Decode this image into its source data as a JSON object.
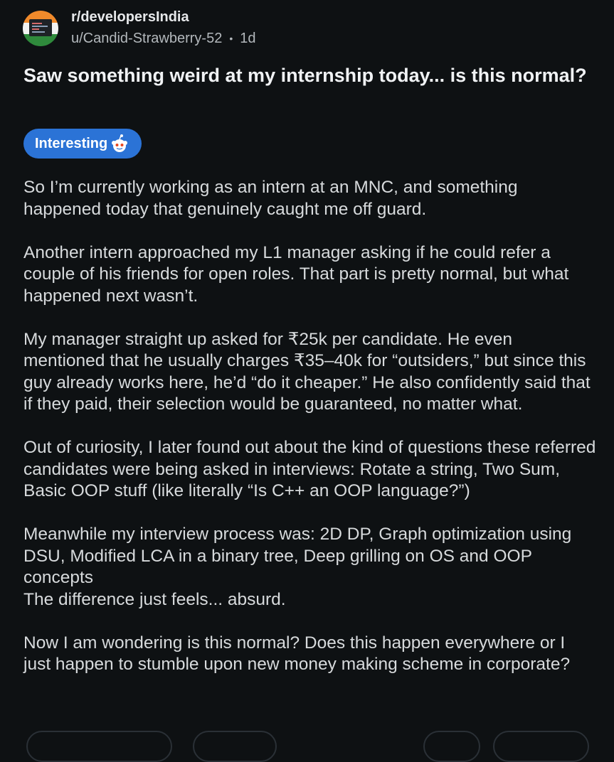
{
  "post": {
    "subreddit": "r/developersIndia",
    "author": "u/Candid-Strawberry-52",
    "separator": "•",
    "age": "1d",
    "title": "Saw something weird at my internship today... is this normal?",
    "flair": "Interesting",
    "body": {
      "p1": "So I’m currently working as an intern at an MNC, and something happened today that genuinely caught me off guard.",
      "p2": "Another intern approached my L1 manager asking if he could refer a couple of his friends for open roles. That part is pretty normal, but what happened next wasn’t.",
      "p3": "My manager straight up asked for ₹25k per candidate. He even mentioned that he usually charges ₹35–40k for “outsiders,” but since this guy already works here, he’d “do it cheaper.” He also confidently said that if they paid, their selection would be guaranteed, no matter what.",
      "p4": "Out of curiosity, I later found out about the kind of questions these referred candidates were being asked in interviews: Rotate a string, Two Sum, Basic OOP stuff (like literally “Is C++ an OOP language?”)",
      "p5a": "Meanwhile my interview process was: 2D DP, Graph optimization using DSU, Modified LCA in a binary tree, Deep grilling on OS and OOP concepts",
      "p5b": "The difference just feels... absurd.",
      "p6": "Now I am wondering is this normal? Does this happen everywhere or I just happen to stumble upon new money making scheme in corporate?"
    }
  },
  "icons": {
    "avatar": "subreddit-avatar-icon",
    "flair_emoji": "snoo-icon"
  },
  "colors": {
    "background": "#0e1113",
    "flair": "#2b73d6",
    "text": "#d7dadc"
  }
}
